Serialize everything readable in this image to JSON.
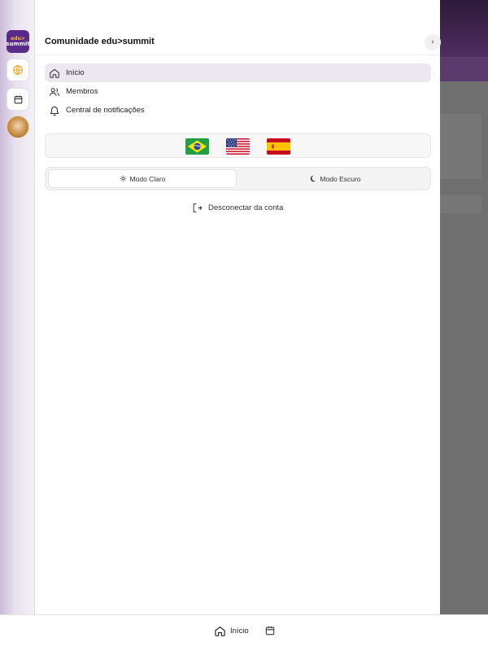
{
  "rail": {
    "logo_line1": "edu>",
    "logo_line2": "summit",
    "globe_icon": "globe-icon",
    "calendar_icon": "calendar-icon"
  },
  "drawer": {
    "title": "Comunidade edu>summit",
    "collapse_icon": "chevron-left-icon",
    "nav": [
      {
        "label": "Início",
        "icon": "home-icon",
        "active": true
      },
      {
        "label": "Membros",
        "icon": "users-icon",
        "active": false
      },
      {
        "label": "Central de notificações",
        "icon": "bell-icon",
        "active": false
      }
    ],
    "languages": [
      "brazil-flag",
      "usa-flag",
      "spain-flag"
    ],
    "modes": {
      "light_label": "Modo Claro",
      "dark_label": "Modo Escuro",
      "selected": "light"
    },
    "logout_label": "Desconectar da conta"
  },
  "bottom_bar": {
    "home_label": "Início"
  },
  "colors": {
    "brand_purple": "#5a2a8a",
    "brand_orange": "#f4b73a",
    "active_bg": "#ede8ef",
    "overlay": "#6f6f6f"
  }
}
